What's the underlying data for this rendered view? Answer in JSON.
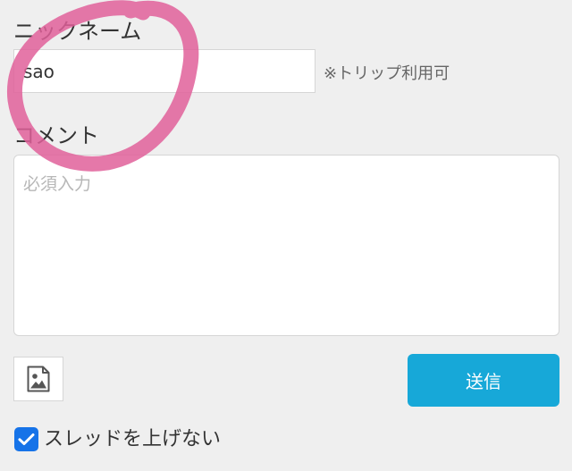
{
  "form": {
    "nickname_label": "ニックネーム",
    "nickname_value": "sao",
    "trip_note": "※トリップ利用可",
    "comment_label": "コメント",
    "comment_placeholder": "必須入力",
    "submit_label": "送信",
    "no_age_label": "スレッドを上げない",
    "no_age_checked": true
  },
  "colors": {
    "submit_bg": "#17a8d8",
    "checkbox_bg": "#1673e8",
    "annotation_circle": "#e0609a"
  },
  "icons": {
    "attach_image": "image-icon",
    "checkbox": "check-icon"
  }
}
